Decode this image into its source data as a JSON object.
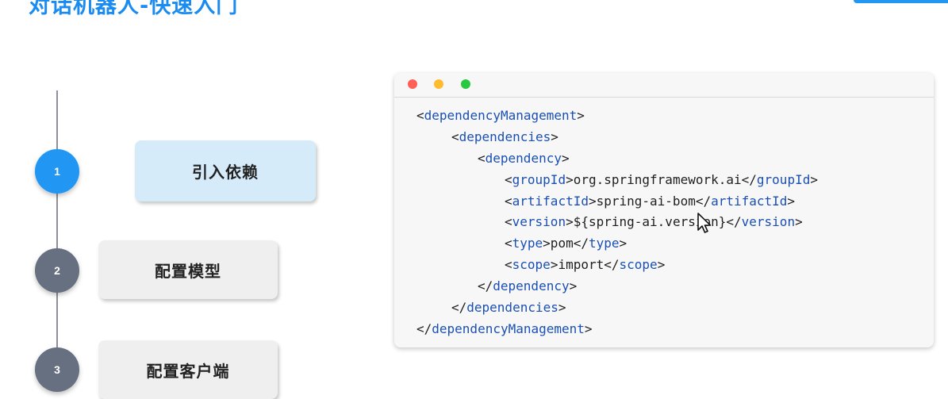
{
  "header": {
    "title": "对话机器人-快速入门"
  },
  "colors": {
    "accent": "#2196f3",
    "title": "#1a8bf0",
    "active_card": "#d5ebf9",
    "inactive_card": "#efefef",
    "inactive_circle": "#667080",
    "code_tag": "#1a4fb5",
    "dot_red": "#ff5f57",
    "dot_yellow": "#febc2e",
    "dot_green": "#28c840"
  },
  "steps": [
    {
      "number": "1",
      "label": "引入依赖",
      "active": true
    },
    {
      "number": "2",
      "label": "配置模型",
      "active": false
    },
    {
      "number": "3",
      "label": "配置客户端",
      "active": false
    }
  ],
  "code": {
    "lines": [
      {
        "indent": 0,
        "tokens": [
          {
            "t": "<"
          },
          {
            "t": "dependencyManagement",
            "tag": true
          },
          {
            "t": ">"
          }
        ]
      },
      {
        "indent": 1,
        "tokens": [
          {
            "t": "<"
          },
          {
            "t": "dependencies",
            "tag": true
          },
          {
            "t": ">"
          }
        ]
      },
      {
        "indent": 2,
        "tokens": [
          {
            "t": "<"
          },
          {
            "t": "dependency",
            "tag": true
          },
          {
            "t": ">"
          }
        ]
      },
      {
        "indent": 3,
        "tokens": [
          {
            "t": "<"
          },
          {
            "t": "groupId",
            "tag": true
          },
          {
            "t": ">org.springframework.ai</"
          },
          {
            "t": "groupId",
            "tag": true
          },
          {
            "t": ">"
          }
        ]
      },
      {
        "indent": 3,
        "tokens": [
          {
            "t": "<"
          },
          {
            "t": "artifactId",
            "tag": true
          },
          {
            "t": ">spring-ai-bom</"
          },
          {
            "t": "artifactId",
            "tag": true
          },
          {
            "t": ">"
          }
        ]
      },
      {
        "indent": 3,
        "tokens": [
          {
            "t": "<"
          },
          {
            "t": "version",
            "tag": true
          },
          {
            "t": ">${spring-ai.version}</"
          },
          {
            "t": "version",
            "tag": true
          },
          {
            "t": ">"
          }
        ]
      },
      {
        "indent": 3,
        "tokens": [
          {
            "t": "<"
          },
          {
            "t": "type",
            "tag": true
          },
          {
            "t": ">pom</"
          },
          {
            "t": "type",
            "tag": true
          },
          {
            "t": ">"
          }
        ]
      },
      {
        "indent": 3,
        "tokens": [
          {
            "t": "<"
          },
          {
            "t": "scope",
            "tag": true
          },
          {
            "t": ">import</"
          },
          {
            "t": "scope",
            "tag": true
          },
          {
            "t": ">"
          }
        ]
      },
      {
        "indent": 2,
        "tokens": [
          {
            "t": "</"
          },
          {
            "t": "dependency",
            "tag": true
          },
          {
            "t": ">"
          }
        ]
      },
      {
        "indent": 1,
        "tokens": [
          {
            "t": "</"
          },
          {
            "t": "dependencies",
            "tag": true
          },
          {
            "t": ">"
          }
        ]
      },
      {
        "indent": 0,
        "tokens": [
          {
            "t": "</"
          },
          {
            "t": "dependencyManagement",
            "tag": true
          },
          {
            "t": ">"
          }
        ]
      }
    ]
  },
  "icons": {
    "cursor": "mouse-pointer-icon",
    "window_controls": [
      "close-dot-icon",
      "minimize-dot-icon",
      "maximize-dot-icon"
    ]
  }
}
